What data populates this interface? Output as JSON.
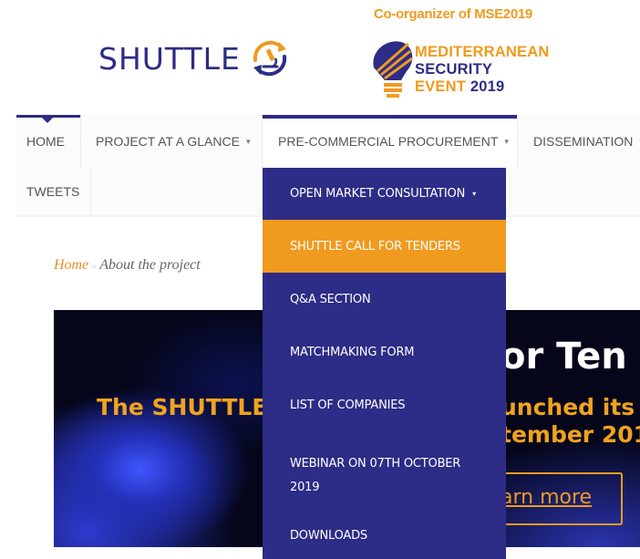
{
  "header": {
    "logo_text": "SHUTTLE",
    "coorganizer": "Co-organizer of MSE2019",
    "mse_lines": [
      "MEDITERRANEAN",
      "SECURITY",
      "EVENT",
      "2019"
    ]
  },
  "nav": {
    "items": [
      {
        "label": "HOME",
        "has_caret": false
      },
      {
        "label": "PROJECT AT A GLANCE",
        "has_caret": true
      },
      {
        "label": "PRE-COMMERCIAL PROCUREMENT",
        "has_caret": true
      },
      {
        "label": "DISSEMINATION",
        "has_caret": true
      },
      {
        "label": "TWEETS",
        "has_caret": false
      }
    ],
    "caret_glyph": "▾"
  },
  "dropdown": {
    "items": [
      {
        "label": "OPEN MARKET CONSULTATION",
        "has_caret": true
      },
      {
        "label": "SHUTTLE CALL FOR TENDERS",
        "active": true
      },
      {
        "label": "Q&A SECTION"
      },
      {
        "label": "MATCHMAKING FORM"
      },
      {
        "label": "LIST OF COMPANIES"
      },
      {
        "label": "WEBINAR ON 07TH OCTOBER 2019"
      },
      {
        "label": "DOWNLOADS"
      }
    ]
  },
  "breadcrumb": {
    "home": "Home",
    "separator": "»",
    "current": "About the project"
  },
  "hero": {
    "title_visible_right": "or Ten",
    "subtitle_left": "The SHUTTLE",
    "subtitle_right_line1": "unched its",
    "subtitle_right_line2": "tember 201",
    "button_visible_text": "arn more"
  },
  "colors": {
    "brand_blue": "#2d2c86",
    "brand_orange": "#f09a1f",
    "hero_bg": "#05061a"
  }
}
